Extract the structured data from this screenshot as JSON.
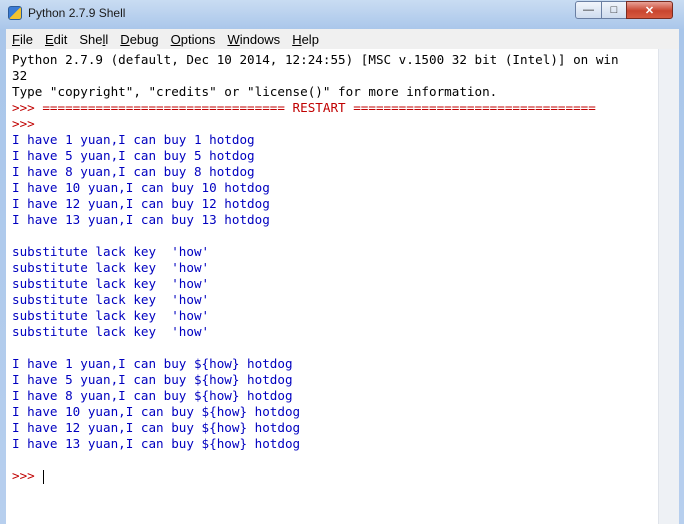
{
  "window": {
    "title": "Python 2.7.9 Shell",
    "icon": "python-icon",
    "controls": {
      "minimize": "—",
      "maximize": "□",
      "close": "✕"
    }
  },
  "menu": {
    "items": [
      {
        "key": "F",
        "rest": "ile"
      },
      {
        "key": "E",
        "rest": "dit"
      },
      {
        "key": "",
        "pre": "She",
        "key2": "l",
        "rest": "l"
      },
      {
        "key": "D",
        "rest": "ebug"
      },
      {
        "key": "O",
        "rest": "ptions"
      },
      {
        "key": "W",
        "rest": "indows"
      },
      {
        "key": "H",
        "rest": "elp"
      }
    ]
  },
  "colors": {
    "stdout": "#0000c0",
    "prompt": "#c00000",
    "normal": "#000000"
  },
  "shell": {
    "lines": [
      {
        "text": "Python 2.7.9 (default, Dec 10 2014, 12:24:55) [MSC v.1500 32 bit (Intel)] on win",
        "kind": "black"
      },
      {
        "text": "32",
        "kind": "black"
      },
      {
        "text": "Type \"copyright\", \"credits\" or \"license()\" for more information.",
        "kind": "black"
      },
      {
        "text": ">>> ================================ RESTART ================================",
        "kind": "red"
      },
      {
        "text": ">>> ",
        "kind": "red"
      },
      {
        "text": "I have 1 yuan,I can buy 1 hotdog",
        "kind": "blue"
      },
      {
        "text": "I have 5 yuan,I can buy 5 hotdog",
        "kind": "blue"
      },
      {
        "text": "I have 8 yuan,I can buy 8 hotdog",
        "kind": "blue"
      },
      {
        "text": "I have 10 yuan,I can buy 10 hotdog",
        "kind": "blue"
      },
      {
        "text": "I have 12 yuan,I can buy 12 hotdog",
        "kind": "blue"
      },
      {
        "text": "I have 13 yuan,I can buy 13 hotdog",
        "kind": "blue"
      },
      {
        "text": "",
        "kind": "blue"
      },
      {
        "text": "substitute lack key  'how'",
        "kind": "blue"
      },
      {
        "text": "substitute lack key  'how'",
        "kind": "blue"
      },
      {
        "text": "substitute lack key  'how'",
        "kind": "blue"
      },
      {
        "text": "substitute lack key  'how'",
        "kind": "blue"
      },
      {
        "text": "substitute lack key  'how'",
        "kind": "blue"
      },
      {
        "text": "substitute lack key  'how'",
        "kind": "blue"
      },
      {
        "text": "",
        "kind": "blue"
      },
      {
        "text": "I have 1 yuan,I can buy ${how} hotdog",
        "kind": "blue"
      },
      {
        "text": "I have 5 yuan,I can buy ${how} hotdog",
        "kind": "blue"
      },
      {
        "text": "I have 8 yuan,I can buy ${how} hotdog",
        "kind": "blue"
      },
      {
        "text": "I have 10 yuan,I can buy ${how} hotdog",
        "kind": "blue"
      },
      {
        "text": "I have 12 yuan,I can buy ${how} hotdog",
        "kind": "blue"
      },
      {
        "text": "I have 13 yuan,I can buy ${how} hotdog",
        "kind": "blue"
      },
      {
        "text": "",
        "kind": "blue"
      },
      {
        "text": ">>> ",
        "kind": "red",
        "cursor": true
      }
    ]
  }
}
